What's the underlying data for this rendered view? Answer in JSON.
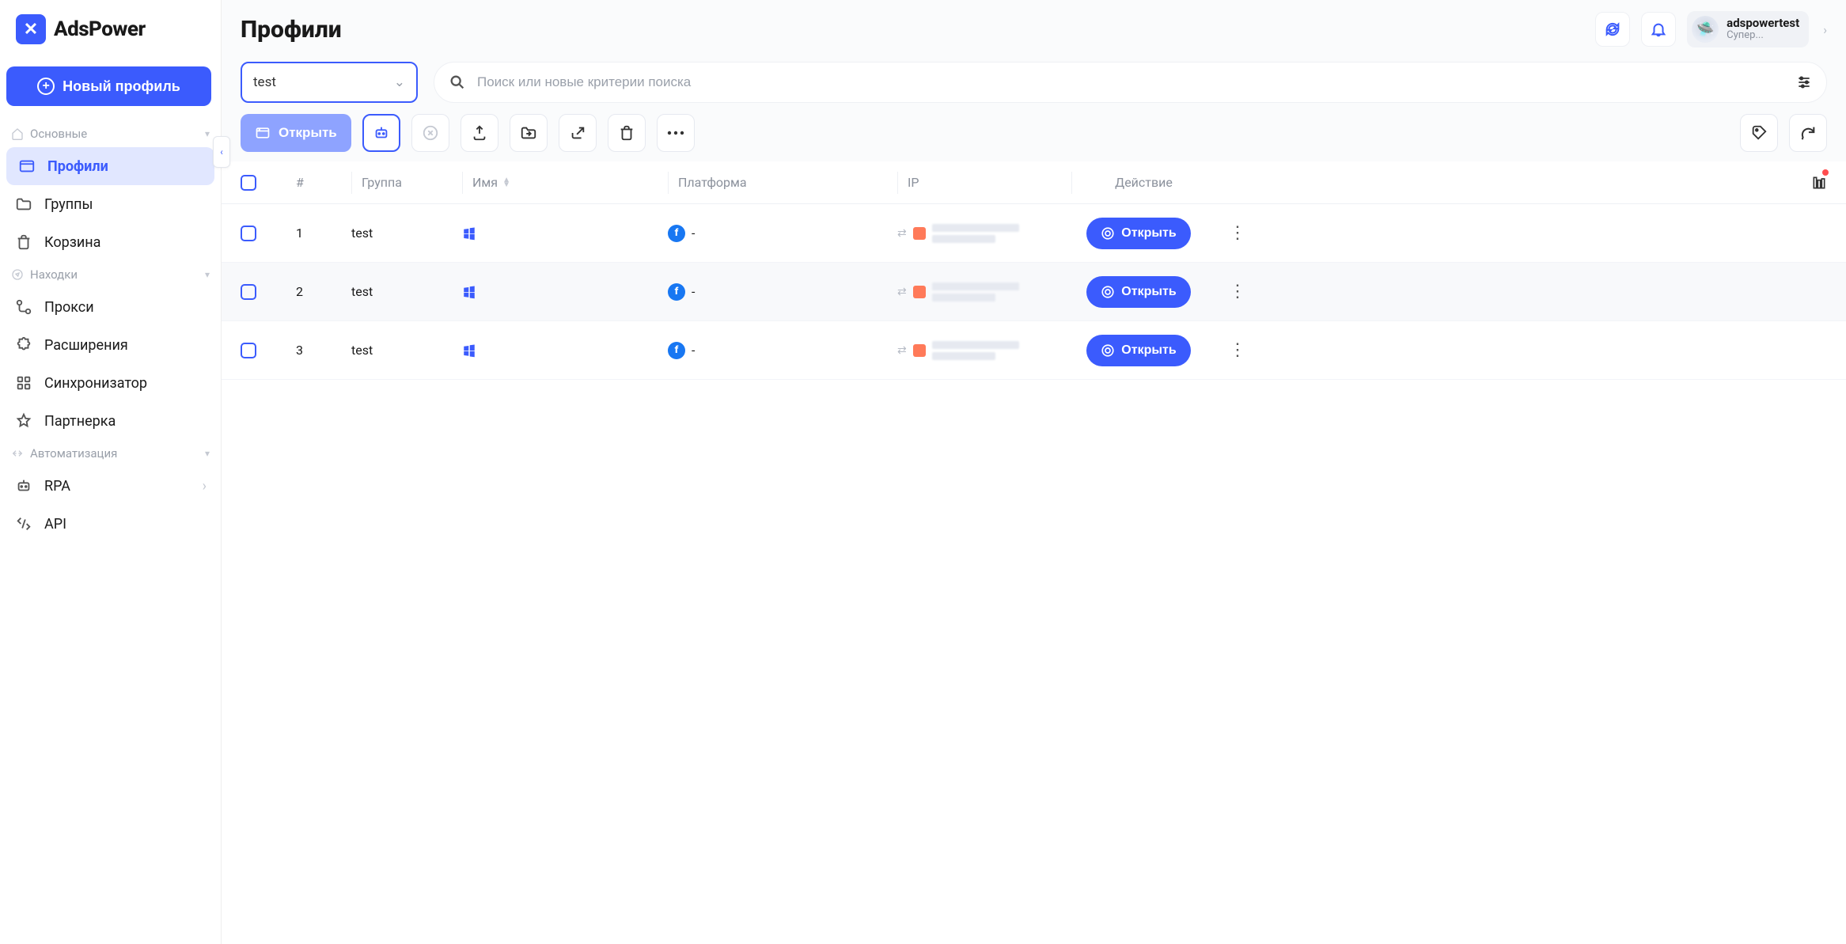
{
  "brand": "AdsPower",
  "header": {
    "title": "Профили",
    "user_name": "adspowertest",
    "user_role": "Супер..."
  },
  "sidebar": {
    "new_profile_label": "Новый профиль",
    "sections": {
      "main": {
        "label": "Основные"
      },
      "finds": {
        "label": "Находки"
      },
      "automation": {
        "label": "Автоматизация"
      }
    },
    "items": {
      "profiles": "Профили",
      "groups": "Группы",
      "trash": "Корзина",
      "proxy": "Прокси",
      "extensions": "Расширения",
      "sync": "Синхронизатор",
      "affiliate": "Партнерка",
      "rpa": "RPA",
      "api": "API"
    }
  },
  "filter": {
    "group_selected": "test",
    "search_placeholder": "Поиск или новые критерии поиска"
  },
  "toolbar": {
    "open_label": "Открыть"
  },
  "table": {
    "columns": {
      "index": "#",
      "group": "Группа",
      "name": "Имя",
      "platform": "Платформа",
      "ip": "IP",
      "action": "Действие"
    },
    "open_label": "Открыть",
    "rows": [
      {
        "index": "1",
        "group": "test",
        "platform_text": "-"
      },
      {
        "index": "2",
        "group": "test",
        "platform_text": "-"
      },
      {
        "index": "3",
        "group": "test",
        "platform_text": "-"
      }
    ]
  }
}
